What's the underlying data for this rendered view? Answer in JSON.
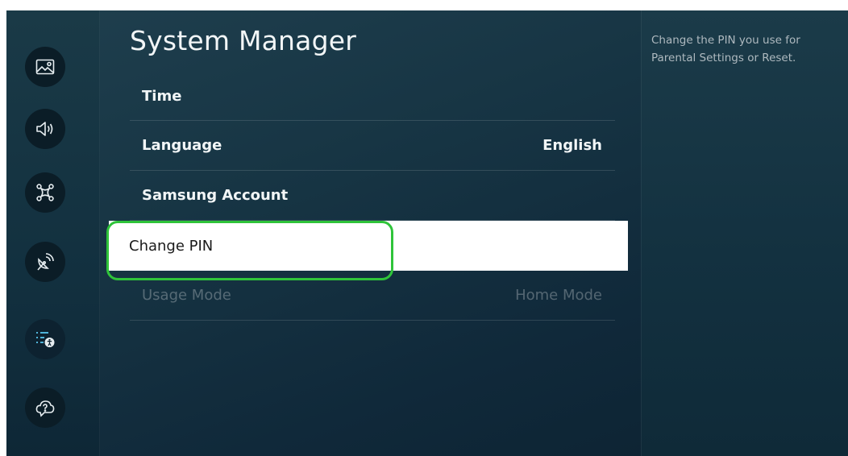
{
  "sidebar": {
    "items": [
      {
        "name": "picture-icon"
      },
      {
        "name": "sound-icon"
      },
      {
        "name": "connection-icon"
      },
      {
        "name": "broadcasting-icon"
      },
      {
        "name": "general-icon",
        "active": true
      },
      {
        "name": "support-icon"
      }
    ]
  },
  "main": {
    "title": "System Manager",
    "items": [
      {
        "label": "Time",
        "value": ""
      },
      {
        "label": "Language",
        "value": "English"
      },
      {
        "label": "Samsung Account",
        "value": ""
      },
      {
        "label": "Change PIN",
        "value": "",
        "state": "focused"
      },
      {
        "label": "Usage Mode",
        "value": "Home Mode",
        "state": "disabled"
      }
    ]
  },
  "help": {
    "text": "Change the PIN you use for Parental Settings or Reset."
  },
  "colors": {
    "background": "#173544",
    "focus_fill": "#ffffff",
    "highlight_ring": "#2fc43a",
    "icon_bg": "#0b1d27"
  }
}
